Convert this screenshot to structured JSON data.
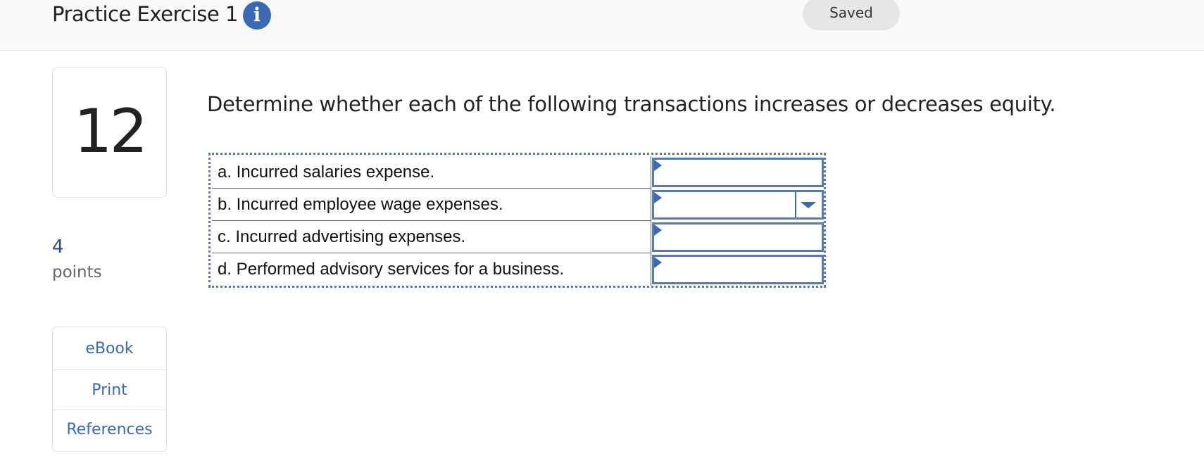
{
  "header": {
    "title": "Practice Exercise 1",
    "info_icon": "i",
    "saved_label": "Saved"
  },
  "question": {
    "number": "12",
    "points_value": "4",
    "points_label": "points",
    "prompt": "Determine whether each of the following transactions increases or decreases equity."
  },
  "side_links": {
    "ebook": "eBook",
    "print": "Print",
    "references": "References"
  },
  "transactions": [
    {
      "label": "a. Incurred salaries expense.",
      "answer": ""
    },
    {
      "label": "b. Incurred employee wage expenses.",
      "answer": ""
    },
    {
      "label": "c. Incurred advertising expenses.",
      "answer": ""
    },
    {
      "label": "d. Performed advisory services for a business.",
      "answer": ""
    }
  ],
  "colors": {
    "accent": "#3a6ab3",
    "points": "#2a4d7f"
  }
}
